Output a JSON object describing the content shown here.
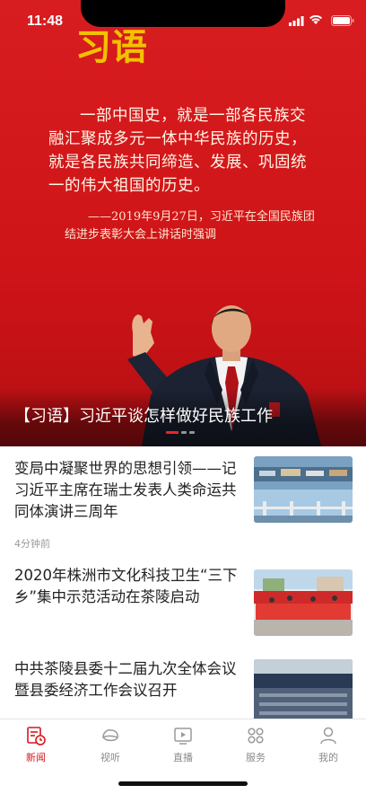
{
  "status": {
    "time": "11:48"
  },
  "hero": {
    "brand_text": "习语",
    "quote": "一部中国史，就是一部各民族交融汇聚成多元一体中华民族的历史，就是各民族共同缔造、发展、巩固统一的伟大祖国的历史。",
    "source": "——2019年9月27日，习近平在全国民族团结进步表彰大会上讲话时强调",
    "caption": "【习语】习近平谈怎样做好民族工作",
    "pager_count": 3,
    "pager_active": 0
  },
  "news": [
    {
      "title": "变局中凝聚世界的思想引领——记习近平主席在瑞士发表人类命运共同体演讲三周年",
      "time": "4分钟前",
      "thumb": "port-bridge"
    },
    {
      "title": "2020年株洲市文化科技卫生“三下乡”集中示范活动在茶陵启动",
      "time": "",
      "thumb": "red-event"
    },
    {
      "title": "中共茶陵县委十二届九次全体会议暨县委经济工作会议召开",
      "time": "",
      "thumb": "meeting-hall"
    }
  ],
  "tabbar": {
    "tabs": [
      {
        "label": "新闻",
        "icon": "news-icon",
        "active": true
      },
      {
        "label": "视听",
        "icon": "video-icon",
        "active": false
      },
      {
        "label": "直播",
        "icon": "live-icon",
        "active": false
      },
      {
        "label": "服务",
        "icon": "service-icon",
        "active": false
      },
      {
        "label": "我的",
        "icon": "profile-icon",
        "active": false
      }
    ]
  },
  "colors": {
    "accent": "#d7161b",
    "hero_red": "#d5171c",
    "brand_gold": "#f2c100"
  }
}
